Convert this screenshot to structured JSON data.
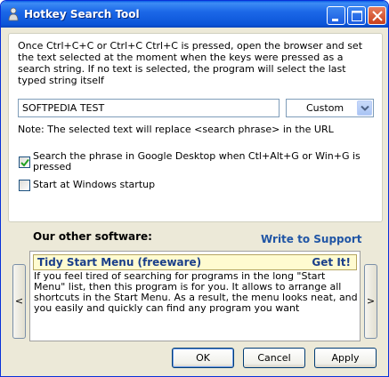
{
  "window": {
    "title": "Hotkey Search Tool"
  },
  "settings": {
    "description": "Once Ctrl+C+C or Ctrl+C Ctrl+C is pressed, open the browser and set the text selected at the moment when the keys were pressed as a search string. If no text is selected, the program will select the last typed string itself",
    "search_value": "SOFTPEDIA TEST",
    "engine_selected": "Custom",
    "note": "Note: The selected text will replace <search phrase> in the URL",
    "google_desktop_label": "Search the phrase in Google Desktop when Ctl+Alt+G or Win+G is pressed",
    "google_desktop_checked": true,
    "startup_label": "Start at Windows startup",
    "startup_checked": false
  },
  "other_software": {
    "heading": "Our other software:",
    "write_link": "Write to Support",
    "prev_label": "<",
    "next_label": ">",
    "promo_name": "Tidy Start Menu (freeware)",
    "promo_get": "Get It!",
    "promo_text": "If you feel tired of searching for programs in the long \"Start Menu\" list, then this program is for you.  It allows to arrange all shortcuts in the Start Menu. As a result, the menu looks neat, and you easily and quickly can find any program you want"
  },
  "buttons": {
    "ok": "OK",
    "cancel": "Cancel",
    "apply": "Apply"
  },
  "icons": {
    "app": "person-search-icon",
    "minimize": "minimize-icon",
    "maximize": "maximize-icon",
    "close": "close-icon",
    "dropdown": "chevron-down-icon",
    "check": "checkmark-icon"
  },
  "colors": {
    "titlebar": "#0b55d8",
    "link": "#2156a5",
    "promo_bg": "#fffbd0",
    "close_button": "#c9401c"
  }
}
